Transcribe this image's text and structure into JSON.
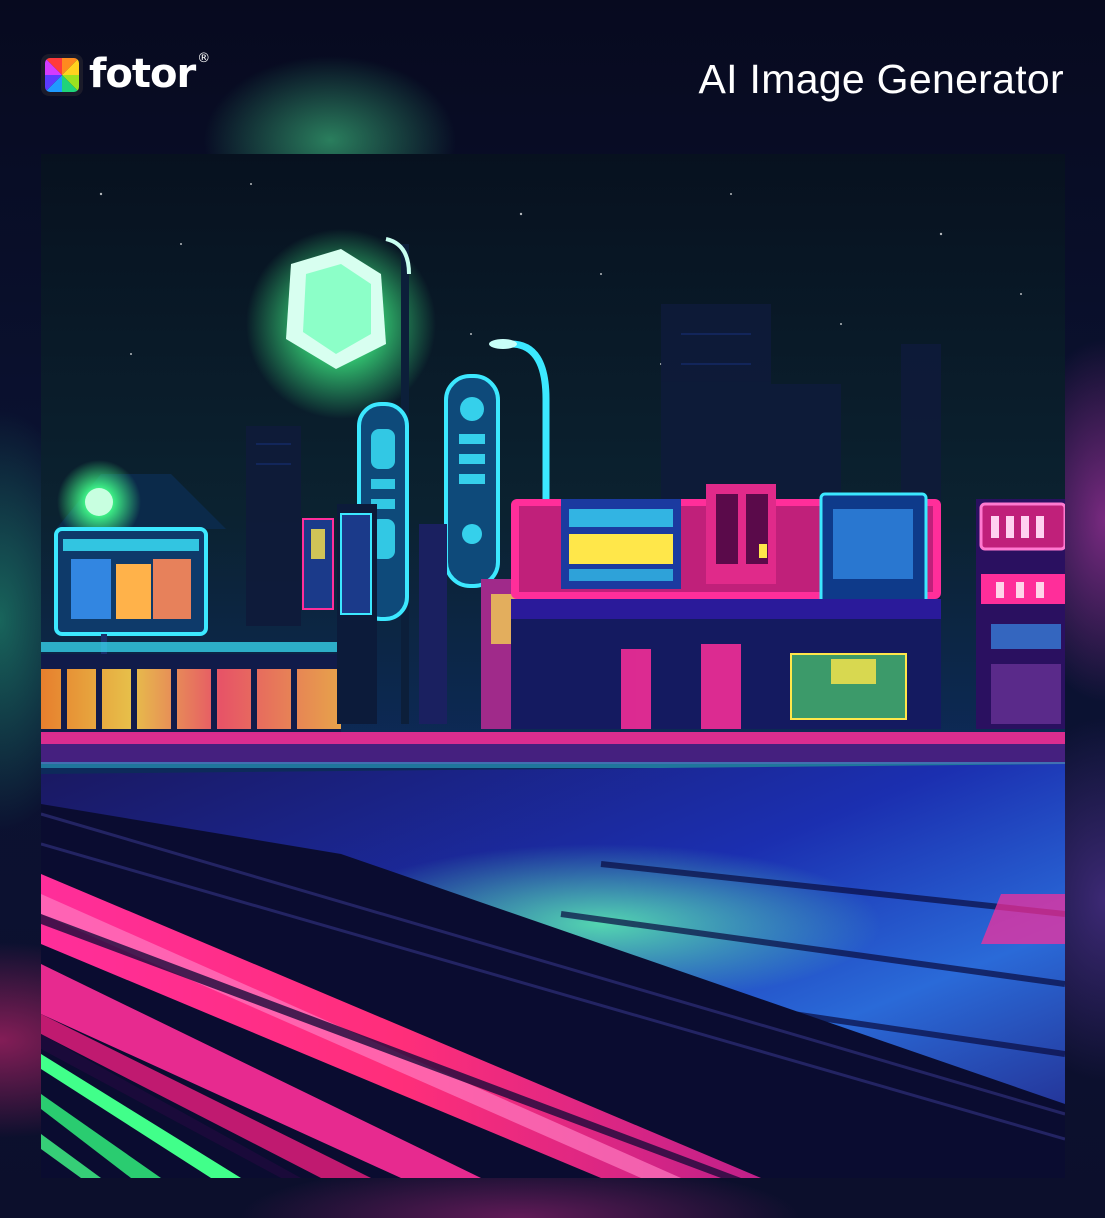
{
  "brand": {
    "name": "fotor",
    "registered_mark": "®",
    "logo_icon": "rainbow-pinwheel-icon"
  },
  "header": {
    "title": "AI Image Generator"
  },
  "artwork": {
    "subject": "neon-night-city-street",
    "colors": {
      "sky": "#0b1a2c",
      "neon_pink": "#ff2e9a",
      "neon_cyan": "#3ce8ff",
      "neon_green": "#41ff8a",
      "neon_blue": "#2a5bff",
      "neon_yellow": "#ffe74a",
      "neon_orange": "#ff8a2a"
    }
  }
}
